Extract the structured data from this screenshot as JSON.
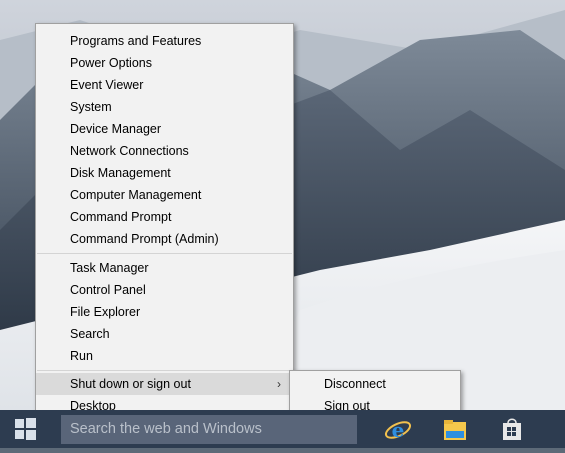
{
  "menu": {
    "groups": [
      [
        "Programs and Features",
        "Power Options",
        "Event Viewer",
        "System",
        "Device Manager",
        "Network Connections",
        "Disk Management",
        "Computer Management",
        "Command Prompt",
        "Command Prompt (Admin)"
      ],
      [
        "Task Manager",
        "Control Panel",
        "File Explorer",
        "Search",
        "Run"
      ]
    ],
    "shutdown_label": "Shut down or sign out",
    "desktop_label": "Desktop"
  },
  "submenu": {
    "items": [
      "Disconnect",
      "Sign out"
    ]
  },
  "taskbar": {
    "search_placeholder": "Search the web and Windows",
    "icons": [
      "windows-start-icon",
      "internet-explorer-icon",
      "file-explorer-icon",
      "store-icon"
    ]
  }
}
